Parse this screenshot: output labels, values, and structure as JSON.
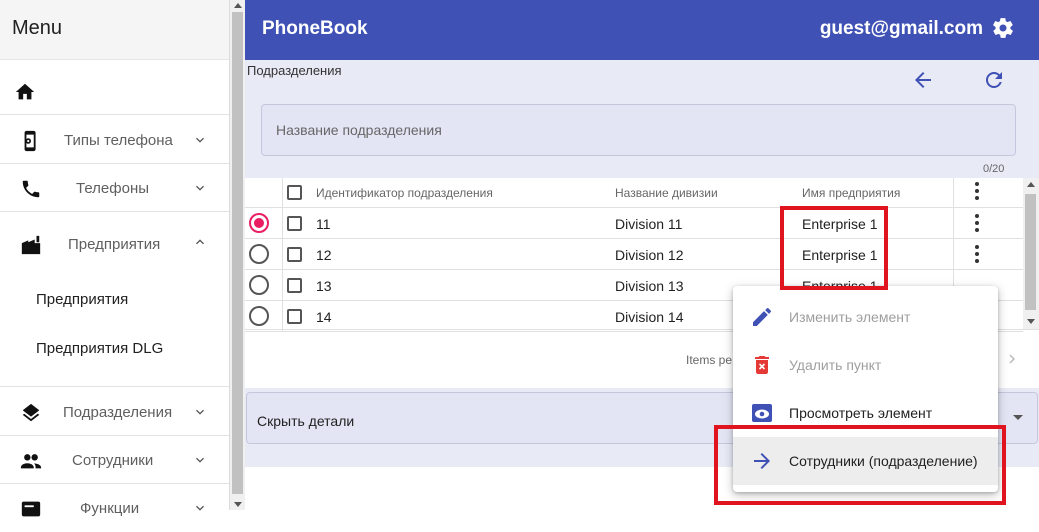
{
  "sidebar": {
    "title": "Menu",
    "items": [
      {
        "label": "Типы телефона"
      },
      {
        "label": "Телефоны"
      },
      {
        "label": "Предприятия"
      },
      {
        "label": "Подразделения"
      },
      {
        "label": "Сотрудники"
      },
      {
        "label": "Функции"
      }
    ],
    "sub_items": [
      "Предприятия",
      "Предприятия DLG"
    ]
  },
  "topbar": {
    "title": "PhoneBook",
    "user": "guest@gmail.com"
  },
  "page": {
    "section_title": "Подразделения",
    "name_field": {
      "placeholder": "Название подразделения",
      "value": "",
      "counter": "0/20"
    }
  },
  "table": {
    "headers": [
      "Идентификатор подразделения",
      "Название дивизии",
      "Имя предприятия"
    ],
    "rows": [
      {
        "id": "11",
        "division": "Division 11",
        "enterprise": "Enterprise 1",
        "selected": true
      },
      {
        "id": "12",
        "division": "Division 12",
        "enterprise": "Enterprise 1",
        "selected": false
      },
      {
        "id": "13",
        "division": "Division 13",
        "enterprise": "Enterprise 1",
        "selected": false
      },
      {
        "id": "14",
        "division": "Division 14",
        "enterprise": "",
        "selected": false
      }
    ],
    "paginator_label": "Items pe"
  },
  "details": {
    "label": "Скрыть детали"
  },
  "context_menu": {
    "items": [
      {
        "label": "Изменить элемент",
        "icon": "pencil-icon",
        "disabled": true
      },
      {
        "label": "Удалить пункт",
        "icon": "trash-icon",
        "disabled": true
      },
      {
        "label": "Просмотреть элемент",
        "icon": "eye-icon",
        "disabled": false
      },
      {
        "label": "Сотрудники (подразделение)",
        "icon": "arrow-right-icon",
        "disabled": false
      }
    ]
  },
  "colors": {
    "primary": "#3f51b5",
    "content_bg": "#e8eaf6",
    "accent_radio": "#e91e63",
    "highlight": "#e0141e",
    "delete_icon": "#e53935"
  }
}
